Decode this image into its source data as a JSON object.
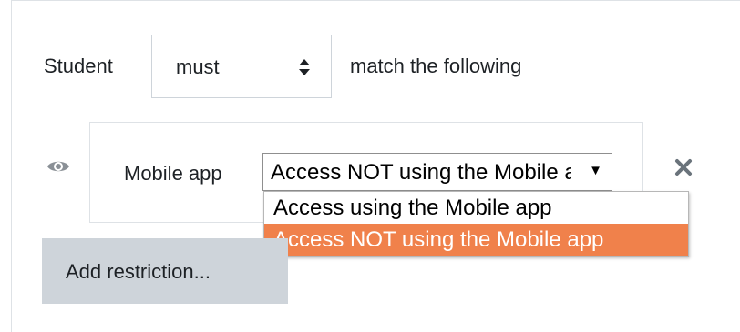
{
  "condition_group": {
    "student_label": "Student",
    "must_select": {
      "value": "must",
      "arrows": "⇕"
    },
    "match_label": "match the following"
  },
  "restriction": {
    "eye_icon": "eye-icon",
    "label": "Mobile app",
    "select_value": "Access NOT using the Mobile app",
    "caret": "▼",
    "close_glyph": "✕",
    "options": [
      "Access using the Mobile app",
      "Access NOT using the Mobile app"
    ],
    "highlighted_option_index": 1
  },
  "add_restriction_label": "Add restriction...",
  "colors": {
    "highlight": "#f0814b",
    "button_bg": "#ced4da",
    "close_icon": "#6a737b"
  }
}
